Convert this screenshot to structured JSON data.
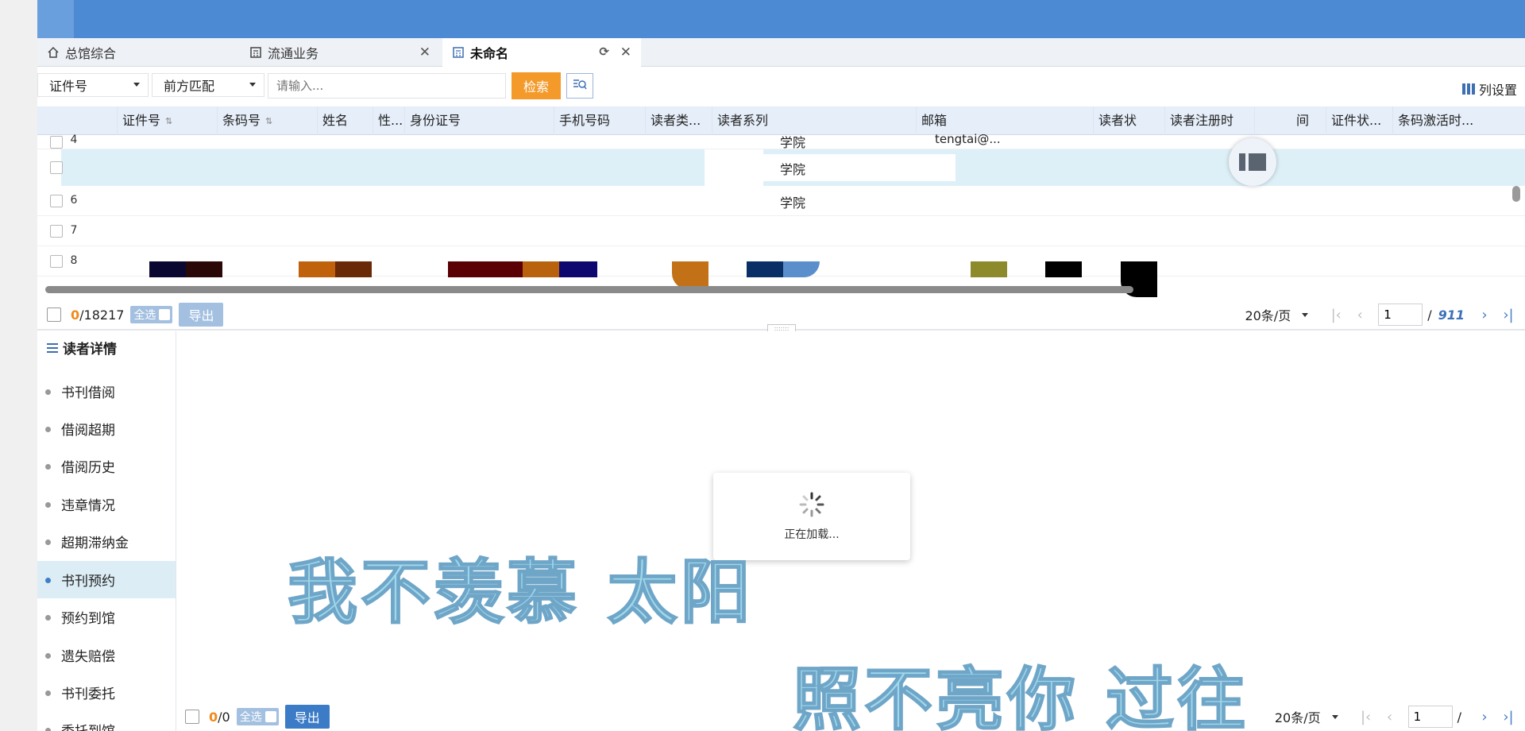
{
  "tabs": [
    {
      "label": "总馆综合",
      "icon": "home-icon"
    },
    {
      "label": "流通业务",
      "icon": "calculator-icon"
    },
    {
      "label": "未命名",
      "icon": "calculator-icon"
    }
  ],
  "toolbar": {
    "field_select": "证件号",
    "match_select": "前方匹配",
    "search_placeholder": "请输入...",
    "search_label": "检索",
    "column_settings": "列设置"
  },
  "grid": {
    "columns": [
      "证件号",
      "条码号",
      "姓名",
      "性...",
      "身份证号",
      "手机号码",
      "读者类...",
      "读者系列",
      "邮箱",
      "读者状",
      "读者注册时",
      "间",
      "证件状...",
      "条码激活时..."
    ],
    "rows": [
      {
        "num": "4",
        "dept": "学院",
        "email": "tengtai@..."
      },
      {
        "num": "",
        "dept": "学院",
        "email": ""
      },
      {
        "num": "6",
        "dept": "学院",
        "email": ""
      },
      {
        "num": "7",
        "dept": "",
        "email": ""
      },
      {
        "num": "8",
        "dept": "",
        "email": ""
      }
    ]
  },
  "top_pager": {
    "selected": "0",
    "total": "/18217",
    "select_all": "全选",
    "export": "导出",
    "page_size": "20条/页",
    "page": "1",
    "pages": "911"
  },
  "detail": {
    "title": "读者详情",
    "items": [
      "书刊借阅",
      "借阅超期",
      "借阅历史",
      "违章情况",
      "超期滞纳金",
      "书刊预约",
      "预约到馆",
      "遗失赔偿",
      "书刊委托",
      "委托到馆"
    ],
    "active_index": 5
  },
  "loading_text": "正在加载...",
  "bottom_pager": {
    "selected": "0",
    "total": "/0",
    "select_all": "全选",
    "export": "导出",
    "page_size": "20条/页",
    "page": "1",
    "pages_sep": "/"
  },
  "watermark": {
    "line1": "我不羡慕  太阳",
    "line2": "照不亮你  过往"
  },
  "colors": {
    "topbar": "#4d8ad4",
    "accent_orange": "#f39a2b",
    "link_blue": "#3c70b8",
    "active_nav": "#dcedf5"
  }
}
